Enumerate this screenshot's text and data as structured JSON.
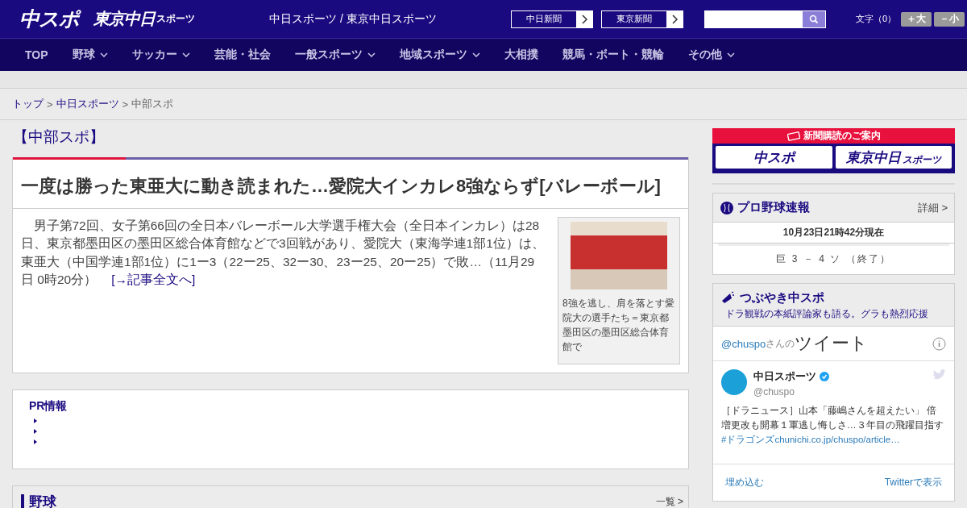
{
  "header": {
    "logo_main": "中スポ",
    "logo_tokyo": "東京中日",
    "logo_tokyo_small": "スポーツ",
    "site_title": "中日スポーツ / 東京中日スポーツ",
    "paper_links": [
      "中日新聞",
      "東京新聞"
    ],
    "font_size_label": "文字（0）",
    "font_buttons": [
      "＋大",
      "－小"
    ]
  },
  "nav": [
    {
      "label": "TOP",
      "dropdown": false
    },
    {
      "label": "野球",
      "dropdown": true
    },
    {
      "label": "サッカー",
      "dropdown": true
    },
    {
      "label": "芸能・社会",
      "dropdown": false
    },
    {
      "label": "一般スポーツ",
      "dropdown": true
    },
    {
      "label": "地域スポーツ",
      "dropdown": true
    },
    {
      "label": "大相撲",
      "dropdown": false
    },
    {
      "label": "競馬・ボート・競輪",
      "dropdown": false
    },
    {
      "label": "その他",
      "dropdown": true
    }
  ],
  "breadcrumb": [
    {
      "label": "トップ",
      "link": true
    },
    {
      "label": "中日スポーツ",
      "link": true,
      "separator": ">"
    },
    {
      "label": "中部スポ",
      "link": false,
      "separator": ">"
    }
  ],
  "section_title": "【中部スポ】",
  "article": {
    "headline": "一度は勝った東亜大に動き読まれた…愛院大インカレ8強ならず[バレーボール]",
    "body": "男子第72回、女子第66回の全日本バレーボール大学選手権大会（全日本インカレ）は28日、東京都墨田区の墨田区総合体育館などで3回戦があり、愛院大（東海学連1部1位）は、東亜大（中国学連1部1位）に1ー3（22ー25、32ー30、23ー25、20ー25）で敗…（11月29日 0時20分）",
    "more_link": "[→記事全文へ]",
    "caption": "8強を逃し、肩を落とす愛院大の選手たち＝東京都墨田区の墨田区総合体育館で"
  },
  "pr": {
    "title": "PR情報"
  },
  "baseball_section": {
    "title": "野球",
    "more": "一覧 >"
  },
  "subscribe": {
    "title": "新聞購読のご案内",
    "logos": [
      "中スポ",
      "東京中日"
    ],
    "logo_small": "スポーツ"
  },
  "scores": {
    "title": "プロ野球速報",
    "details": "詳細 >",
    "timestamp": "10月23日21時42分現在",
    "games": [
      "巨 3 － 4 ソ （終了）"
    ]
  },
  "twitter": {
    "title": "つぶやき中スポ",
    "subtitle": "ドラ観戦の本紙評論家も語る。グラも熱烈応援",
    "handle_prefix": "@chuspo",
    "handle_suffix": "さんの",
    "heading": "ツイート",
    "account_name": "中日スポーツ",
    "account_handle": "@chuspo",
    "tweet": "［ドラニュース］山本「藤嶋さんを超えたい」 倍増更改も開幕１軍逃し悔しさ…３年目の飛躍目指す",
    "tweet_link": "#ドラゴンズchunichi.co.jp/chuspo/article…",
    "embed": "埋め込む",
    "view": "Twitterで表示"
  }
}
